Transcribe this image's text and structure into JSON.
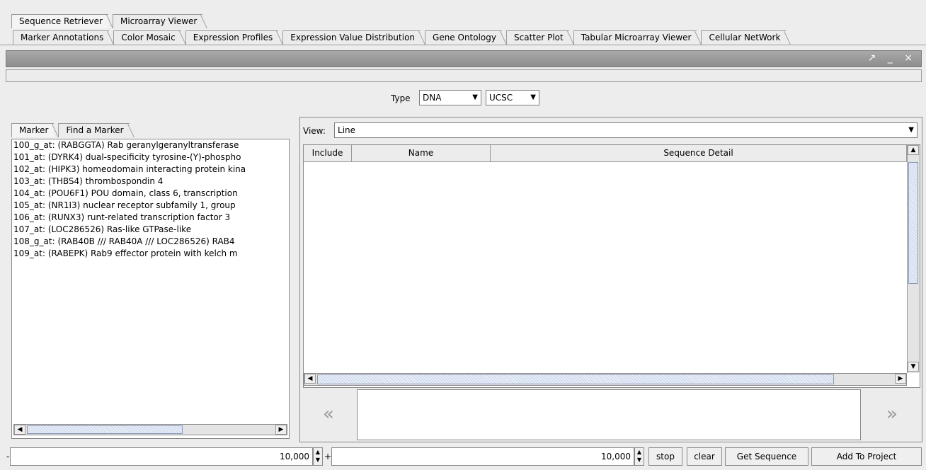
{
  "top_tabs": [
    "Sequence Retriever",
    "Microarray Viewer"
  ],
  "view_tabs": [
    "Marker Annotations",
    "Color Mosaic",
    "Expression Profiles",
    "Expression Value Distribution",
    "Gene Ontology",
    "Scatter Plot",
    "Tabular Microarray Viewer",
    "Cellular NetWork"
  ],
  "window_controls": "↗ _ ×",
  "type_label": "Type",
  "type_value": "DNA",
  "source_value": "UCSC",
  "left_tabs": [
    "Marker",
    "Find a Marker"
  ],
  "markers": [
    "100_g_at: (RABGGTA) Rab geranylgeranyltransferase",
    "101_at: (DYRK4) dual-specificity tyrosine-(Y)-phospho",
    "102_at: (HIPK3) homeodomain interacting protein kina",
    "103_at: (THBS4) thrombospondin 4",
    "104_at: (POU6F1) POU domain, class 6, transcription",
    "105_at: (NR1I3) nuclear receptor subfamily 1, group",
    "106_at: (RUNX3) runt-related transcription factor 3",
    "107_at: (LOC286526) Ras-like GTPase-like",
    "108_g_at: (RAB40B /// RAB40A /// LOC286526) RAB4",
    "109_at: (RABEPK) Rab9 effector protein with kelch m"
  ],
  "view_label": "View:",
  "view_value": "Line",
  "table_headers": [
    "Include",
    "Name",
    "Sequence Detail"
  ],
  "nav_prev": "«",
  "nav_next": "»",
  "bottom": {
    "minus": "-",
    "upstream": "10,000",
    "plus": "+",
    "downstream": "10,000",
    "stop": "stop",
    "clear": "clear",
    "get_sequence": "Get Sequence",
    "add_to_project": "Add To Project"
  }
}
